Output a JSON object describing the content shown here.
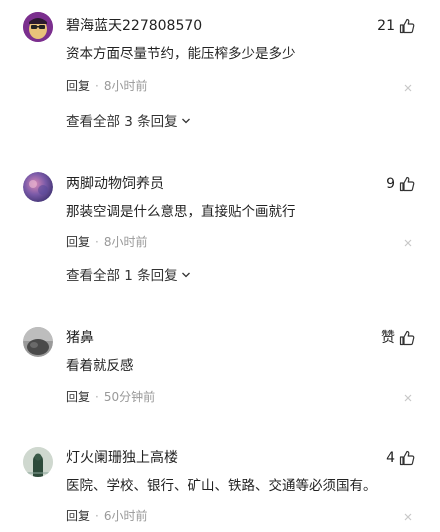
{
  "comments": [
    {
      "username": "碧海蓝天227808570",
      "likes": "21",
      "text": "资本方面尽量节约，能压榨多少是多少",
      "reply_label": "回复",
      "separator": "·",
      "time": "8小时前",
      "view_replies": "查看全部 3 条回复"
    },
    {
      "username": "两脚动物饲养员",
      "likes": "9",
      "text": "那装空调是什么意思，直接贴个画就行",
      "reply_label": "回复",
      "separator": "·",
      "time": "8小时前",
      "view_replies": "查看全部 1 条回复"
    },
    {
      "username": "猪鼻",
      "likes": "赞",
      "text": "看着就反感",
      "reply_label": "回复",
      "separator": "·",
      "time": "50分钟前"
    },
    {
      "username": "灯火阑珊独上高楼",
      "likes": "4",
      "text": "医院、学校、银行、矿山、铁路、交通等必须国有。",
      "reply_label": "回复",
      "separator": "·",
      "time": "6小时前"
    }
  ],
  "icons": {
    "like": "thumbs-up-icon",
    "close": "close-icon",
    "expand": "chevron-down-icon"
  }
}
